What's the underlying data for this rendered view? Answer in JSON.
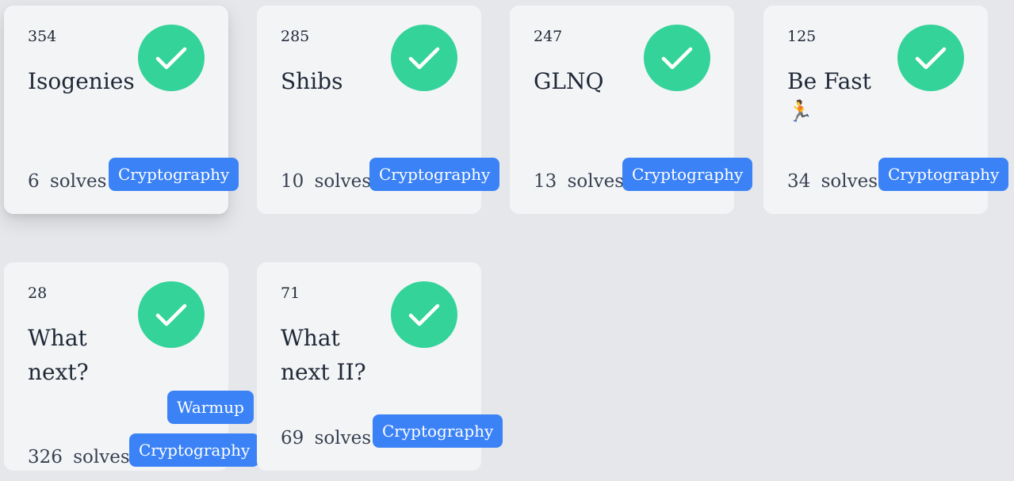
{
  "accent_colors": {
    "solved": "#34d399",
    "tag": "#3b82f6",
    "card": "#f3f4f6",
    "background": "#e5e7eb"
  },
  "solves_label": "solves",
  "challenges": [
    {
      "points": "354",
      "title": "Isogenies",
      "emoji": "",
      "solves": "6",
      "tags": [
        "Cryptography"
      ],
      "solved": true
    },
    {
      "points": "285",
      "title": "Shibs",
      "emoji": "",
      "solves": "10",
      "tags": [
        "Cryptography"
      ],
      "solved": true
    },
    {
      "points": "247",
      "title": "GLNQ",
      "emoji": "",
      "solves": "13",
      "tags": [
        "Cryptography"
      ],
      "solved": true
    },
    {
      "points": "125",
      "title": "Be Fast",
      "emoji": "🏃",
      "solves": "34",
      "tags": [
        "Cryptography"
      ],
      "solved": true
    },
    {
      "points": "28",
      "title": "What next?",
      "emoji": "",
      "solves": "326",
      "tags": [
        "Warmup",
        "Cryptography"
      ],
      "solved": true
    },
    {
      "points": "71",
      "title": "What next II?",
      "emoji": "",
      "solves": "69",
      "tags": [
        "Cryptography"
      ],
      "solved": true
    }
  ]
}
